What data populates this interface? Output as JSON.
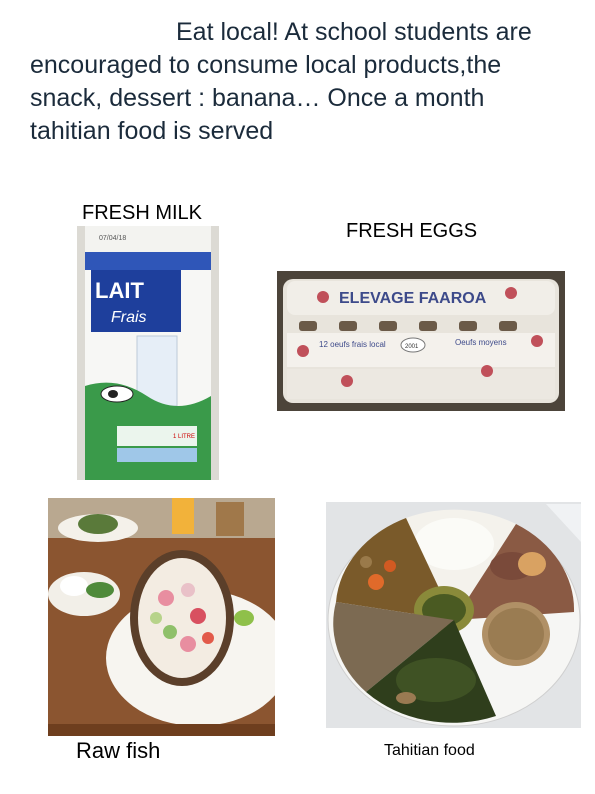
{
  "intro": {
    "text": "Eat local!  At school students are encouraged to consume local products,the snack, dessert : banana… Once a month tahitian food is served"
  },
  "captions": {
    "milk": "FRESH MILK",
    "eggs": "FRESH EGGS",
    "fish": "Raw fish",
    "tahitian": "Tahitian food"
  },
  "milk_carton": {
    "date": "07/04/18",
    "brand": "LAIT",
    "sub": "Frais",
    "volume": "1 LITRE"
  },
  "egg_tray": {
    "farm": "ELEVAGE FAAROA",
    "label1": "12 oeufs frais local",
    "label2": "Oeufs moyens",
    "stamp": "2001"
  },
  "colors": {
    "intro_text": "#1b2b3b",
    "carton_blue": "#1e3f9c"
  }
}
